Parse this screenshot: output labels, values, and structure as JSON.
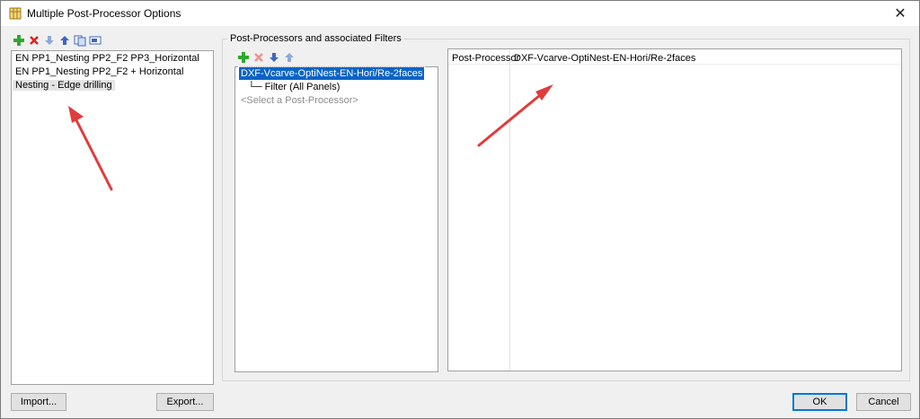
{
  "window": {
    "title": "Multiple Post-Processor Options",
    "close_glyph": "✕"
  },
  "left_panel": {
    "items": [
      "EN PP1_Nesting PP2_F2 PP3_Horizontal",
      "EN PP1_Nesting PP2_F2 + Horizontal",
      "Nesting - Edge drilling"
    ]
  },
  "group": {
    "label": "Post-Processors and associated Filters"
  },
  "tree": {
    "selected": "DXF-Vcarve-OptiNest-EN-Hori/Re-2faces",
    "child_prefix": "└─",
    "child": "Filter (All Panels)",
    "placeholder": "<Select a Post-Processor>"
  },
  "properties": {
    "label": "Post-Processor",
    "value": "DXF-Vcarve-OptiNest-EN-Hori/Re-2faces"
  },
  "buttons": {
    "import": "Import...",
    "export": "Export...",
    "ok": "OK",
    "cancel": "Cancel"
  },
  "icons": [
    "add-icon",
    "delete-icon",
    "move-down-icon",
    "move-up-icon",
    "copy-icon",
    "rename-icon",
    "close-icon",
    "app-icon",
    "annotation-arrow"
  ],
  "colors": {
    "selection": "#0a64c8",
    "default_button_border": "#0078d7",
    "annotation_arrow": "#e03c3c"
  }
}
